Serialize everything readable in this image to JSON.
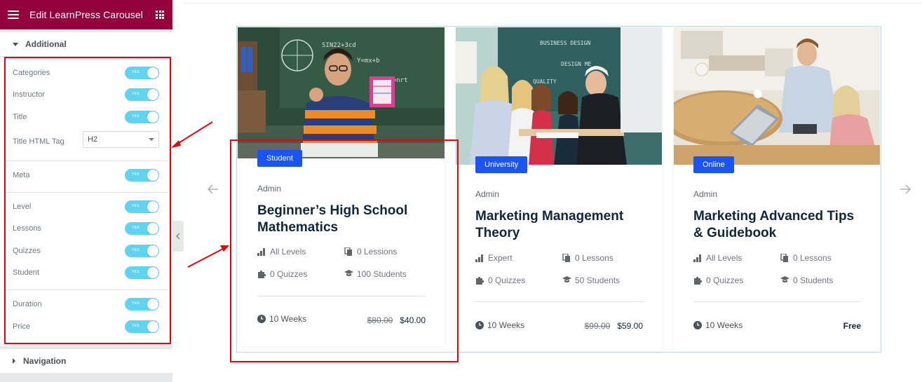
{
  "panel": {
    "title": "Edit LearnPress Carousel",
    "section_additional": "Additional",
    "section_navigation": "Navigation",
    "toggle_text": "YES",
    "controls": {
      "categories": "Categories",
      "instructor": "Instructor",
      "title": "Title",
      "title_html_tag": "Title HTML Tag",
      "title_html_tag_value": "H2",
      "meta": "Meta",
      "level": "Level",
      "lessons": "Lessons",
      "quizzes": "Quizzes",
      "student": "Student",
      "duration": "Duration",
      "price": "Price"
    }
  },
  "colors": {
    "panel_header": "#93003c",
    "toggle_on": "#5fd3ef",
    "badge": "#1a54f4",
    "highlight": "#e3000f"
  },
  "cards": [
    {
      "category": "Student",
      "author": "Admin",
      "title": "Beginner’s High School Mathematics",
      "level": "All Levels",
      "lessons": "0 Lessions",
      "quizzes": "0 Quizzes",
      "students": "100 Students",
      "duration": "10 Weeks",
      "old_price": "$80.00",
      "price": "$40.00"
    },
    {
      "category": "University",
      "author": "Admin",
      "title": "Marketing Management Theory",
      "level": "Expert",
      "lessons": "0 Lessons",
      "quizzes": "0 Quizzes",
      "students": "50 Students",
      "duration": "10 Weeks",
      "old_price": "$99.00",
      "price": "$59.00"
    },
    {
      "category": "Online",
      "author": "Admin",
      "title": "Marketing Advanced Tips & Guidebook",
      "level": "All Levels",
      "lessons": "0 Lessons",
      "quizzes": "0 Quizzes",
      "students": "0 Students",
      "duration": "10 Weeks",
      "price": "Free"
    }
  ],
  "icons": {
    "menu": "hamburger-icon",
    "apps": "grid-icon",
    "prev": "arrow-left-icon",
    "next": "arrow-right-icon",
    "level": "bar-chart-icon",
    "lessons": "copy-icon",
    "quizzes": "puzzle-icon",
    "students": "graduation-cap-icon",
    "duration": "clock-icon"
  }
}
